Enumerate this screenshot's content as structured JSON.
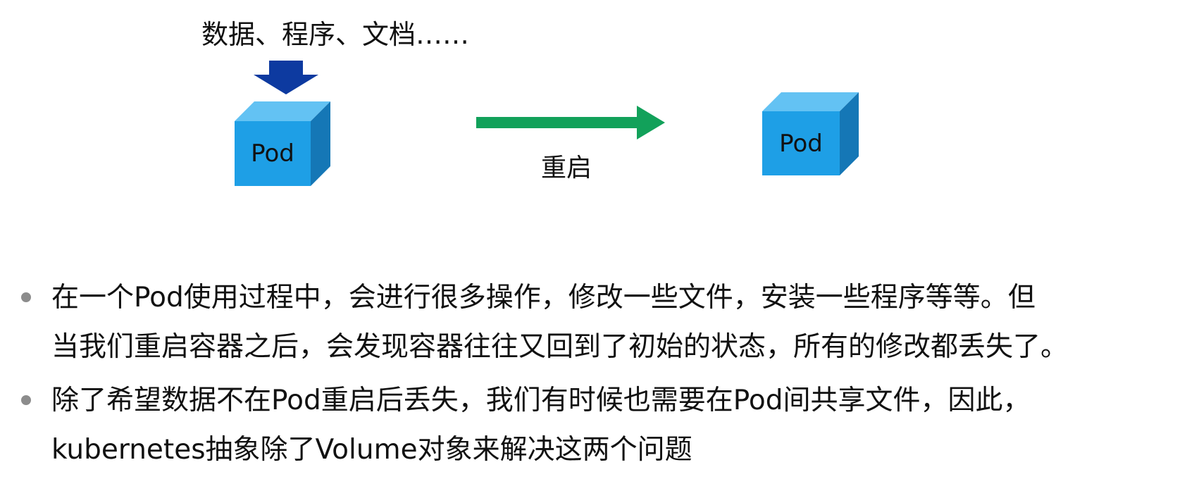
{
  "diagram": {
    "input_caption": "数据、程序、文档……",
    "pod_before_label": "Pod",
    "pod_after_label": "Pod",
    "transition_label": "重启",
    "colors": {
      "input_arrow": "#0d3aa0",
      "transition_arrow": "#12a15a",
      "cube_front": "#1e9fe6",
      "cube_top": "#63c2f3",
      "cube_side": "#1577b6"
    }
  },
  "bullets": [
    {
      "lines": [
        "在一个Pod使用过程中，会进行很多操作，修改一些文件，安装一些程序等等。但",
        "当我们重启容器之后，会发现容器往往又回到了初始的状态，所有的修改都丢失了。"
      ]
    },
    {
      "lines": [
        "除了希望数据不在Pod重启后丢失，我们有时候也需要在Pod间共享文件，因此，",
        "kubernetes抽象除了Volume对象来解决这两个问题"
      ]
    }
  ]
}
